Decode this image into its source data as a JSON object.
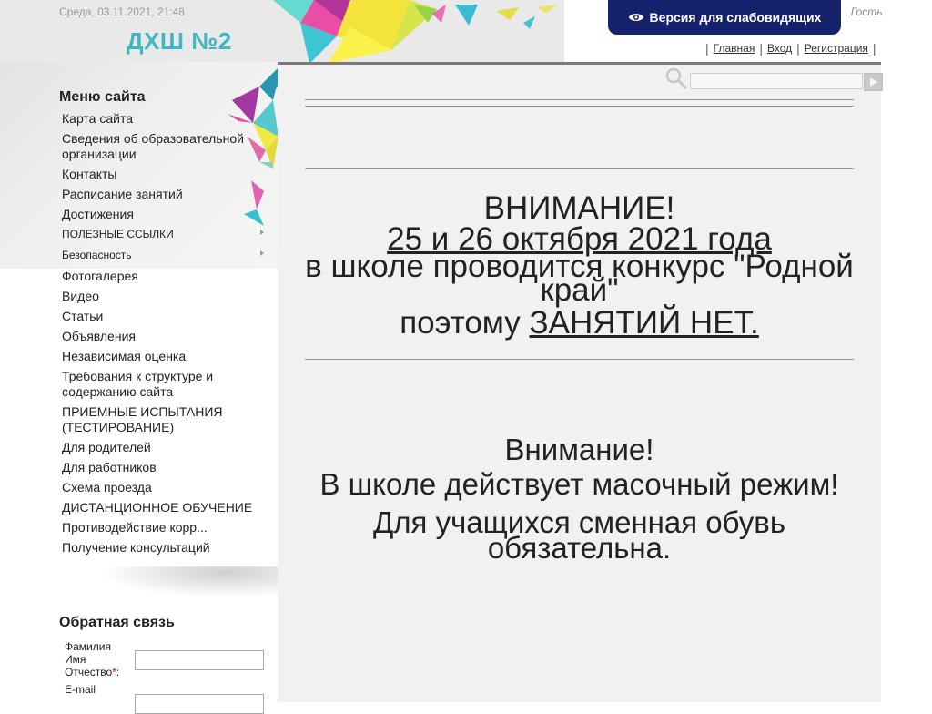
{
  "header": {
    "date": "Среда, 03.11.2021, 21:48",
    "site_title": "ДХШ №2",
    "vision_button": "Версия для слабовидящих",
    "guest_text": "Гость",
    "links": [
      "Главная",
      "Вход",
      "Регистрация"
    ]
  },
  "menu": {
    "title": "Меню сайта",
    "items": [
      {
        "label": "Карта сайта"
      },
      {
        "label": "Сведения об образовательной организации"
      },
      {
        "label": "Контакты"
      },
      {
        "label": "Расписание занятий"
      },
      {
        "label": "Достижения"
      },
      {
        "label": "ПОЛЕЗНЫЕ ССЫЛКИ"
      },
      {
        "label": "Безопасность"
      },
      {
        "label": "Фотогалерея"
      },
      {
        "label": "Видео"
      },
      {
        "label": "Статьи"
      },
      {
        "label": "Объявления"
      },
      {
        "label": "Независимая оценка"
      },
      {
        "label": "Требования к структуре и содержанию сайта"
      },
      {
        "label": "ПРИЕМНЫЕ ИСПЫТАНИЯ (ТЕСТИРОВАНИЕ)"
      },
      {
        "label": "Для родителей"
      },
      {
        "label": "Для работников"
      },
      {
        "label": "Схема проезда"
      },
      {
        "label": "ДИСТАНЦИОННОЕ ОБУЧЕНИЕ"
      },
      {
        "label": "Противодействие корр..."
      },
      {
        "label": "Получение консультаций"
      }
    ]
  },
  "notice1": {
    "line1": "ВНИМАНИЕ!",
    "line2": "25 и 26 октября 2021 года",
    "line3": "в школе проводится конкурс \"Родной край\"",
    "line4_prefix": "поэтому ",
    "line4_underlined": "ЗАНЯТИЙ НЕТ."
  },
  "notice2": {
    "line1": "Внимание!",
    "line2": "В школе действует масочный режим!",
    "line3": "Для учащихся сменная обувь обязательна."
  },
  "feedback": {
    "title": "Обратная связь",
    "name_label": "Фамилия Имя Отчество",
    "required_mark": "*",
    "email_label": "E-mail"
  },
  "colors": {
    "site_title": "#3fb8c6",
    "vision_button_bg": "#16216b",
    "main_bg": "#f1f1f1"
  }
}
